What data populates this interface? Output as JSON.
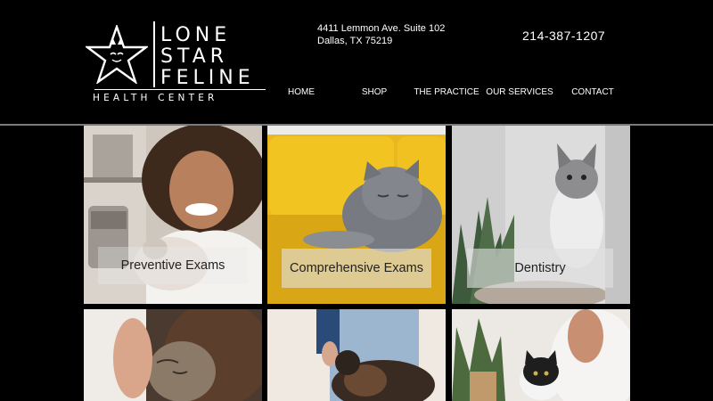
{
  "brand": {
    "line1": "LONE",
    "line2": "STAR",
    "line3": "FELINE",
    "tagline": "HEALTH CENTER"
  },
  "contact": {
    "address_line1": "4411 Lemmon Ave. Suite 102",
    "address_line2": "Dallas, TX 75219",
    "phone": "214-387-1207"
  },
  "nav": {
    "items": [
      "HOME",
      "SHOP",
      "THE PRACTICE",
      "OUR SERVICES",
      "CONTACT"
    ]
  },
  "services": {
    "tiles": [
      {
        "label": "Preventive Exams"
      },
      {
        "label": "Comprehensive Exams"
      },
      {
        "label": "Dentistry"
      }
    ]
  },
  "colors": {
    "background": "#000000",
    "header_divider": "#7a7a7a",
    "text": "#ffffff"
  }
}
